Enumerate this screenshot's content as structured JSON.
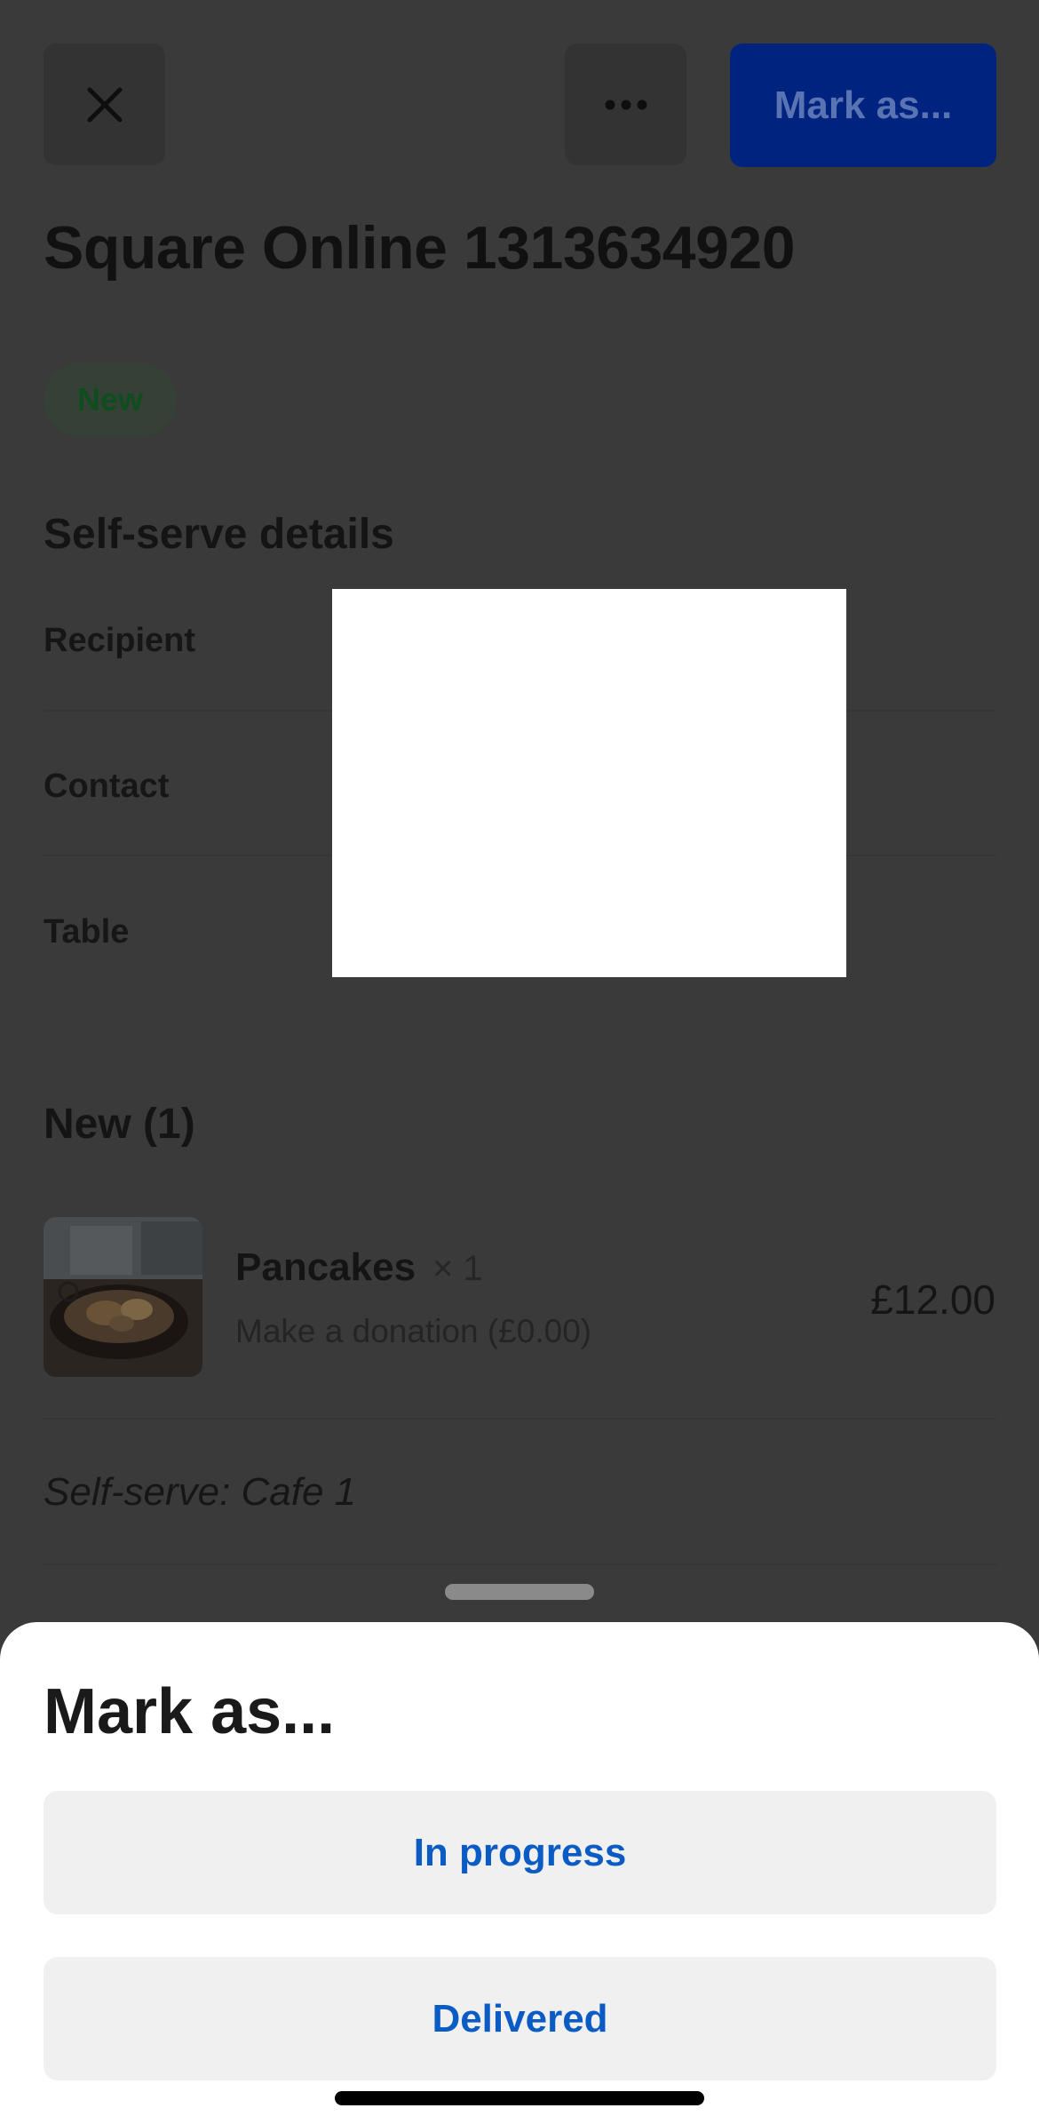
{
  "header": {
    "mark_as_label": "Mark as..."
  },
  "order": {
    "title": "Square Online 1313634920",
    "status": "New"
  },
  "details": {
    "heading": "Self-serve details",
    "labels": [
      "Recipient",
      "Contact",
      "Table"
    ]
  },
  "items_section": {
    "heading": "New (1)",
    "items": [
      {
        "name": "Pancakes",
        "quantity": "× 1",
        "modifier": "Make a donation (£0.00)",
        "price": "£12.00"
      }
    ],
    "note": "Self-serve: Cafe 1"
  },
  "sheet": {
    "title": "Mark as...",
    "options": [
      "In progress",
      "Delivered"
    ]
  },
  "colors": {
    "primary_button": "#00237f",
    "badge_text": "#0f4c1e",
    "option_text": "#0a5bc4",
    "scrim": "#3a3a3a"
  },
  "icons": {
    "close": "close-icon",
    "more": "more-horizontal-icon",
    "thumbnail": "pancakes-photo"
  }
}
